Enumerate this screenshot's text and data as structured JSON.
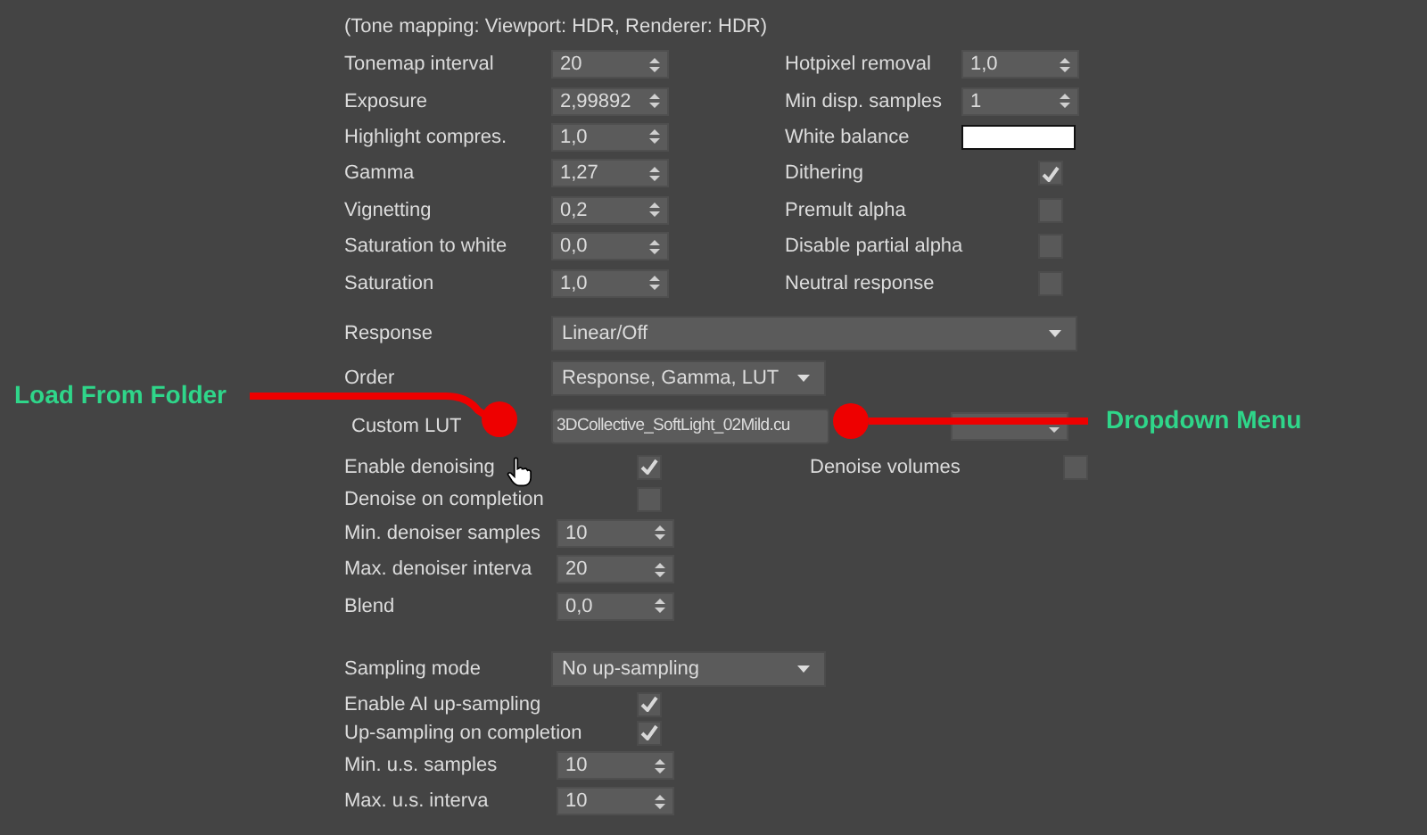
{
  "header": "(Tone mapping: Viewport: HDR, Renderer: HDR)",
  "left": [
    {
      "label": "Tonemap interval",
      "value": "20"
    },
    {
      "label": "Exposure",
      "value": "2,99892"
    },
    {
      "label": "Highlight compres.",
      "value": "1,0"
    },
    {
      "label": "Gamma",
      "value": "1,27"
    },
    {
      "label": "Vignetting",
      "value": "0,2"
    },
    {
      "label": "Saturation to white",
      "value": "0,0"
    },
    {
      "label": "Saturation",
      "value": "1,0"
    }
  ],
  "right": [
    {
      "kind": "spin",
      "label": "Hotpixel removal",
      "value": "1,0"
    },
    {
      "kind": "spin",
      "label": "Min disp. samples",
      "value": "1"
    },
    {
      "kind": "color",
      "label": "White balance",
      "color": "#ffffff"
    },
    {
      "kind": "check",
      "label": "Dithering",
      "checked": true
    },
    {
      "kind": "check",
      "label": "Premult alpha",
      "checked": false
    },
    {
      "kind": "check",
      "label": "Disable partial alpha",
      "checked": false
    },
    {
      "kind": "check",
      "label": "Neutral response",
      "checked": false
    }
  ],
  "response": {
    "label": "Response",
    "value": "Linear/Off"
  },
  "order": {
    "label": "Order",
    "value": "Response, Gamma, LUT"
  },
  "custom_lut": {
    "label": "Custom LUT",
    "value": "3DCollective_SoftLight_02Mild.cu"
  },
  "denoise": [
    {
      "kind": "check",
      "label": "Enable denoising",
      "checked": true,
      "side": {
        "label": "Denoise volumes",
        "checked": false
      }
    },
    {
      "kind": "check",
      "label": "Denoise on completion",
      "checked": false
    },
    {
      "kind": "spin",
      "label": "Min. denoiser samples",
      "value": "10"
    },
    {
      "kind": "spin",
      "label": "Max. denoiser interva",
      "value": "20"
    },
    {
      "kind": "spin",
      "label": "Blend",
      "value": "0,0"
    }
  ],
  "sampling_mode": {
    "label": "Sampling mode",
    "value": "No up-sampling"
  },
  "upsampling": [
    {
      "kind": "check",
      "label": "Enable AI up-sampling",
      "checked": true
    },
    {
      "kind": "check",
      "label": "Up-sampling on completion",
      "checked": true
    },
    {
      "kind": "spin",
      "label": "Min. u.s. samples",
      "value": "10"
    },
    {
      "kind": "spin",
      "label": "Max. u.s. interva",
      "value": "10"
    }
  ],
  "annotations": [
    {
      "label": "Load From Folder"
    },
    {
      "label": "Dropdown Menu"
    }
  ]
}
